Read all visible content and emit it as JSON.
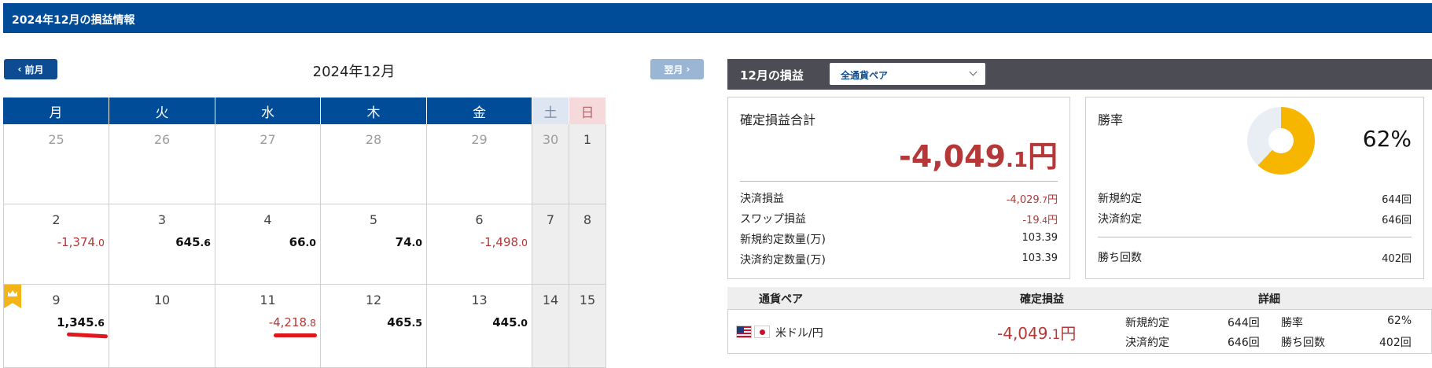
{
  "page": {
    "title": "2024年12月の損益情報"
  },
  "calendar": {
    "prev_label": "前月",
    "next_label": "翌月",
    "month_title": "2024年12月",
    "weekdays": [
      "月",
      "火",
      "水",
      "木",
      "金",
      "土",
      "日"
    ],
    "weeks": [
      [
        {
          "day": "25",
          "amt_int": "",
          "amt_dec": ""
        },
        {
          "day": "26",
          "amt_int": "",
          "amt_dec": ""
        },
        {
          "day": "27",
          "amt_int": "",
          "amt_dec": ""
        },
        {
          "day": "28",
          "amt_int": "",
          "amt_dec": ""
        },
        {
          "day": "29",
          "amt_int": "",
          "amt_dec": ""
        },
        {
          "day": "30",
          "amt_int": "",
          "amt_dec": ""
        },
        {
          "day": "1",
          "amt_int": "",
          "amt_dec": ""
        }
      ],
      [
        {
          "day": "2",
          "amt_int": "-1,374",
          "amt_dec": ".0"
        },
        {
          "day": "3",
          "amt_int": "645",
          "amt_dec": ".6"
        },
        {
          "day": "4",
          "amt_int": "66",
          "amt_dec": ".0"
        },
        {
          "day": "5",
          "amt_int": "74",
          "amt_dec": ".0"
        },
        {
          "day": "6",
          "amt_int": "-1,498",
          "amt_dec": ".0"
        },
        {
          "day": "7",
          "amt_int": "",
          "amt_dec": ""
        },
        {
          "day": "8",
          "amt_int": "",
          "amt_dec": ""
        }
      ],
      [
        {
          "day": "9",
          "amt_int": "1,345",
          "amt_dec": ".6"
        },
        {
          "day": "10",
          "amt_int": "",
          "amt_dec": ""
        },
        {
          "day": "11",
          "amt_int": "-4,218",
          "amt_dec": ".8"
        },
        {
          "day": "12",
          "amt_int": "465",
          "amt_dec": ".5"
        },
        {
          "day": "13",
          "amt_int": "445",
          "amt_dec": ".0"
        },
        {
          "day": "14",
          "amt_int": "",
          "amt_dec": ""
        },
        {
          "day": "15",
          "amt_int": "",
          "amt_dec": ""
        }
      ]
    ]
  },
  "summary": {
    "label": "12月の損益",
    "pair_select": "全通貨ペア",
    "total_title": "確定損益合計",
    "total_int": "-4,049",
    "total_dec": ".1",
    "total_unit": "円",
    "rows": [
      {
        "label": "決済損益",
        "int": "-4,029",
        "dec": ".7",
        "unit": "円"
      },
      {
        "label": "スワップ損益",
        "int": "-19",
        "dec": ".4",
        "unit": "円"
      },
      {
        "label": "新規約定数量(万)",
        "int": "103.39",
        "dec": "",
        "unit": ""
      },
      {
        "label": "決済約定数量(万)",
        "int": "103.39",
        "dec": "",
        "unit": ""
      }
    ],
    "winrate_title": "勝率",
    "winrate_value": "62%",
    "winrate_fraction": 0.62,
    "win_rows": [
      {
        "label": "新規約定",
        "value": "644",
        "unit": "回"
      },
      {
        "label": "決済約定",
        "value": "646",
        "unit": "回"
      },
      {
        "label": "勝ち回数",
        "value": "402",
        "unit": "回"
      }
    ]
  },
  "table": {
    "headers": {
      "pair": "通貨ペア",
      "pnl": "確定損益",
      "detail": "詳細"
    },
    "row": {
      "pair": "米ドル/円",
      "pnl_int": "-4,049",
      "pnl_dec": ".1",
      "pnl_unit": "円",
      "new_label": "新規約定",
      "new_value": "644回",
      "settle_label": "決済約定",
      "settle_value": "646回",
      "winrate_label": "勝率",
      "winrate_value": "62%",
      "wins_label": "勝ち回数",
      "wins_value": "402回"
    }
  },
  "colors": {
    "brand": "#004c99",
    "negative": "#b53737",
    "gold": "#f6b600"
  }
}
